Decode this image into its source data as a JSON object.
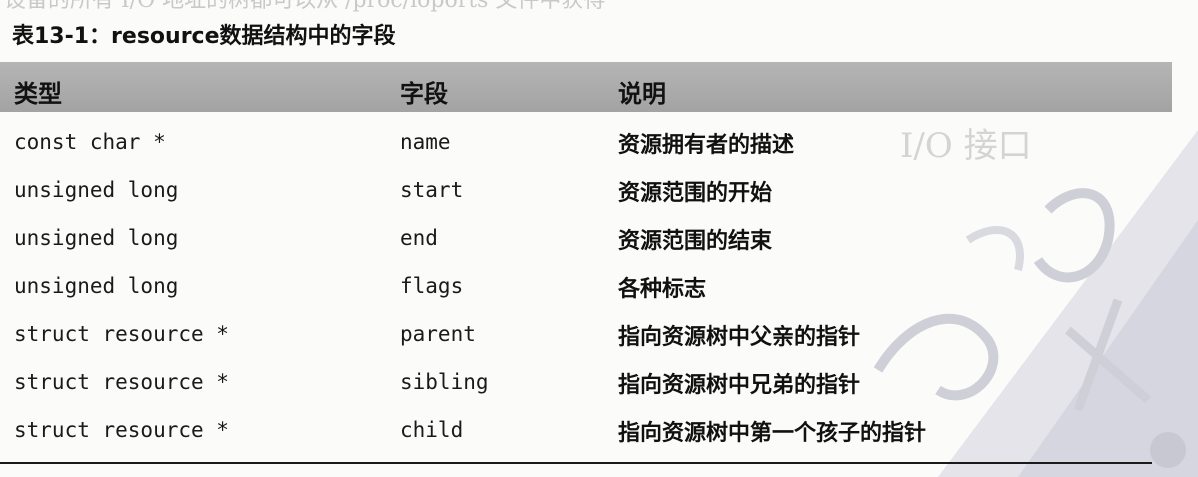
{
  "caption": "表13-1：resource数据结构中的字段",
  "columns": [
    "类型",
    "字段",
    "说明"
  ],
  "rows": [
    {
      "type": "const char *",
      "field": "name",
      "desc": "资源拥有者的描述"
    },
    {
      "type": "unsigned long",
      "field": "start",
      "desc": "资源范围的开始"
    },
    {
      "type": "unsigned long",
      "field": "end",
      "desc": "资源范围的结束"
    },
    {
      "type": "unsigned long",
      "field": "flags",
      "desc": "各种标志"
    },
    {
      "type": "struct resource *",
      "field": "parent",
      "desc": "指向资源树中父亲的指针"
    },
    {
      "type": "struct resource *",
      "field": "sibling",
      "desc": "指向资源树中兄弟的指针"
    },
    {
      "type": "struct resource *",
      "field": "child",
      "desc": "指向资源树中第一个孩子的指针"
    }
  ],
  "colors": {
    "header_band": "#a8a8a8",
    "rule": "#1a1a1a",
    "watermark": "#d8d8e4"
  }
}
